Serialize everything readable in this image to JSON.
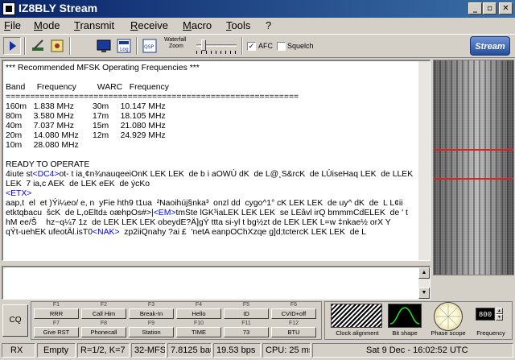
{
  "window": {
    "title": "IZ8BLY Stream",
    "minimize": "_",
    "maximize": "▫",
    "close": "✕"
  },
  "menu": [
    "File",
    "Mode",
    "Transmit",
    "Receive",
    "Macro",
    "Tools",
    "?"
  ],
  "toolbar": {
    "waterfall_zoom_label_1": "Waterfall",
    "waterfall_zoom_label_2": "Zoom",
    "afc_label": "AFC",
    "afc_checked": true,
    "squelch_label": "Squelch",
    "squelch_checked": false,
    "logo": "Stream",
    "icons": [
      "play-icon",
      "edit-icon",
      "settings-icon",
      "monitor-icon",
      "log-icon",
      "qsp-icon"
    ]
  },
  "rx": {
    "lines": [
      "*** Recommended MFSK Operating Frequencies ***",
      "",
      "Band     Frequency         WARC   Frequency",
      "============================================================",
      "160m   1.838 MHz        30m     10.147 MHz",
      "80m     3.580 MHz        17m     18.105 MHz",
      "40m     7.037 MHz        15m     21.080 MHz",
      "20m     14.080 MHz      12m     24.929 MHz",
      "10m     28.080 MHz",
      "",
      "READY TO OPERATE"
    ],
    "garbled": [
      [
        {
          "t": "4iute st"
        },
        {
          "t": "<DC4>",
          "c": 1
        },
        {
          "t": "ot- t ia¸¢n¾nauqeeiOnK LEK LEK  de b i aOWÚ dK  de L@¸S&rcK  de LÚiseHaq LEK  de LLEK"
        }
      ],
      [
        {
          "t": "LEK  7 ia,c AEK  de LEK eEK  de ýcKo"
        }
      ],
      [
        {
          "t": "<ETX>",
          "c": 1
        }
      ],
      [
        {
          "t": "aap,t  el  et )Ýi¼eo/ e, n  yFie hth9 t1ua  ²Naoihúj§nka³  onzl dd  cygo^1° cK LEK LEK  de uy^ dK  de  L L¢ii"
        }
      ],
      [
        {
          "t": "etktqbacu  šcK  de L,oEltd± oæhpOs#>|"
        },
        {
          "t": "<EM>",
          "c": 1
        },
        {
          "t": "tmSte lGK³iaLEK LEK LEK  se LEâvl irQ bmmmCdELEK  de ' t"
        }
      ],
      [
        {
          "t": "hM ee/Š    hz~q¼7 1z  de LEK LEK LEK obeydE?Ä]gÝ ttta si-yl t bg½zt de LEK LEK L=w ‡nkae½ orX Y"
        }
      ],
      [
        {
          "t": "qÝt-uehEK ufeotÄl.isT0"
        },
        {
          "t": "<NAK>",
          "c": 1
        },
        {
          "t": "  zp2iiQnahy ?ai £  'netA eanpOChXzqe g]d;tctercK LEK LEK  de L"
        }
      ]
    ]
  },
  "macros": {
    "cq_label": "CQ",
    "buttons": [
      {
        "key": "F1",
        "label": "RRR"
      },
      {
        "key": "F2",
        "label": "Call Him"
      },
      {
        "key": "F3",
        "label": "Break-In"
      },
      {
        "key": "F4",
        "label": "Hello"
      },
      {
        "key": "F5",
        "label": "ID"
      },
      {
        "key": "F6",
        "label": "CVID+off"
      },
      {
        "key": "F7",
        "label": "Give RST"
      },
      {
        "key": "F8",
        "label": "Phonecall"
      },
      {
        "key": "F9",
        "label": "Station"
      },
      {
        "key": "F10",
        "label": "TIME"
      },
      {
        "key": "F11",
        "label": "73"
      },
      {
        "key": "F12",
        "label": "BTU"
      }
    ]
  },
  "tools": {
    "clock_alignment": "Clock alignment",
    "bit_shape": "Bit shape",
    "phase_scope": "Phase scope",
    "frequency": "Frequency",
    "frequency_value": "800"
  },
  "status": {
    "mode": "RX",
    "buffer": "Empty",
    "code": "R=1/2, K=7",
    "modem": "32-MFSK",
    "baud": "7.8125 baud",
    "bps": "19.53 bps",
    "cpu": "CPU: 25 ms (18%)",
    "datetime": "Sat 9 Dec - 16:02:52 UTC"
  },
  "colors": {
    "title_gradient_start": "#0a246a",
    "title_gradient_end": "#3a6ea5",
    "control_code": "#0000ff",
    "waterfall_marker": "#e02020"
  }
}
